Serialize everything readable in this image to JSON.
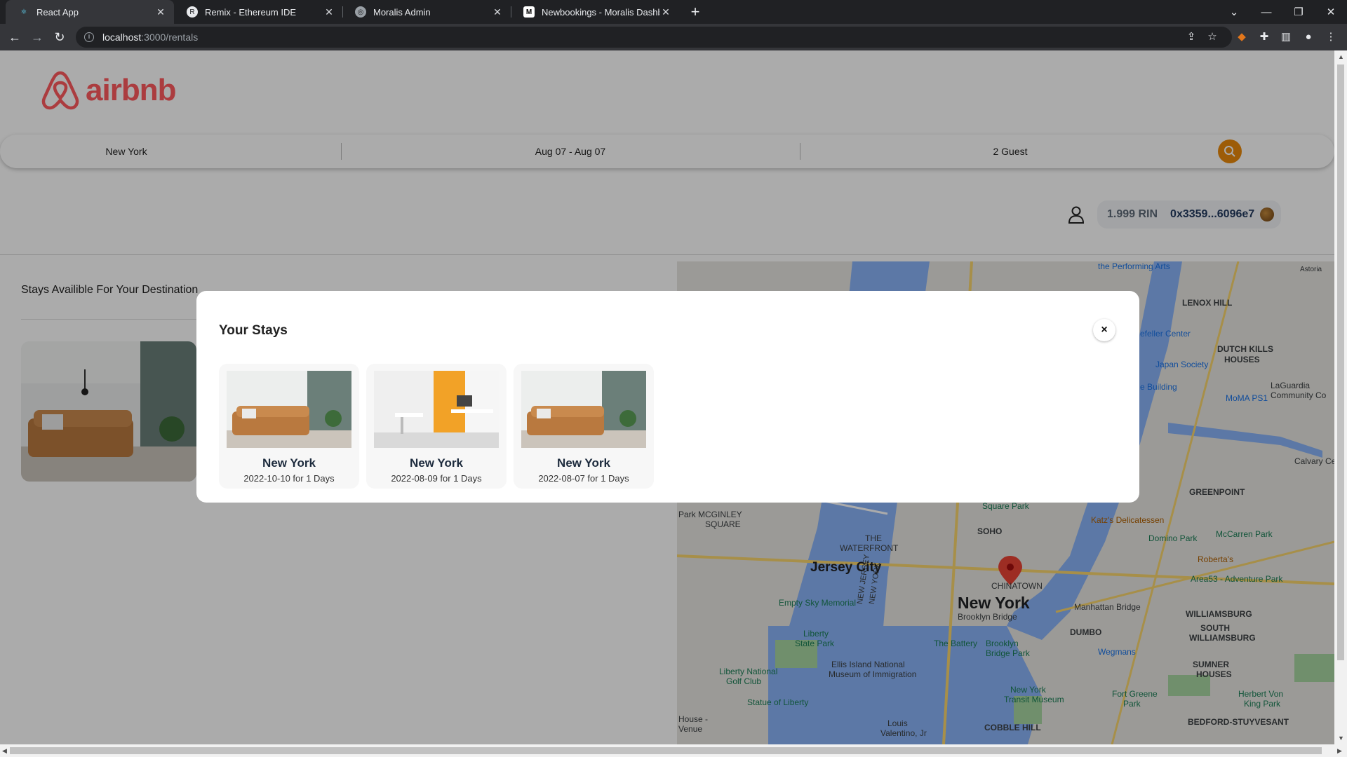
{
  "browser": {
    "tabs": [
      {
        "title": "React App",
        "active": true,
        "favicon": "react-icon"
      },
      {
        "title": "Remix - Ethereum IDE",
        "active": false,
        "favicon": "remix-icon"
      },
      {
        "title": "Moralis Admin",
        "active": false,
        "favicon": "moralis-icon"
      },
      {
        "title": "Newbookings - Moralis Dashboard",
        "active": false,
        "favicon": "moralis-m-icon"
      }
    ],
    "url_host": "localhost",
    "url_path": ":3000/rentals"
  },
  "header": {
    "logo_text": "airbnb",
    "search": {
      "location": "New York",
      "dates": "Aug 07 - Aug 07",
      "guests": "2 Guest"
    },
    "wallet": {
      "balance": "1.999 RIN",
      "address": "0x3359...6096e7"
    }
  },
  "main": {
    "stays_title": "Stays Availible For Your Destination"
  },
  "map": {
    "labels": [
      "the Performing Arts",
      "LENOX HILL",
      "Astoria",
      "efeller Center",
      "DUTCH KILLS",
      "HOUSES",
      "Japan Society",
      "e Building",
      "MoMA PS1",
      "LaGuardia",
      "Community Co",
      "Calvary Ce",
      "GREENPOINT",
      "Square Park",
      "Katz's Delicatessen",
      "Domino Park",
      "McCarren Park",
      "SOHO",
      "Park MCGINLEY",
      "SQUARE",
      "THE",
      "WATERFRONT",
      "Jersey City",
      "CHINATOWN",
      "New York",
      "Area53 - Adventure Park",
      "Manhattan Bridge",
      "WILLIAMSBURG",
      "Brooklyn Bridge",
      "Empty Sky Memorial",
      "Liberty",
      "State Park",
      "The Battery",
      "DUMBO",
      "SOUTH",
      "WILLIAMSBURG",
      "Roberta's",
      "Wegmans",
      "Brooklyn Bridge Park",
      "Liberty National",
      "Golf Club",
      "Ellis Island National",
      "Museum of Immigration",
      "SUMNER",
      "HOUSES",
      "New York",
      "Transit Museum",
      "Fort Greene",
      "Park",
      "Herbert Von",
      "King Park",
      "Statue of Liberty",
      "House -",
      "Venue",
      "Louis",
      "Valentino, Jr",
      "COBBLE HILL",
      "BEDFORD-STUYVESANT",
      "NEW JERSEY",
      "NEW YORK"
    ]
  },
  "modal": {
    "title": "Your Stays",
    "close_label": "×",
    "stays": [
      {
        "city": "New York",
        "detail": "2022-10-10 for 1 Days"
      },
      {
        "city": "New York",
        "detail": "2022-08-09 for 1 Days"
      },
      {
        "city": "New York",
        "detail": "2022-08-07 for 1 Days"
      }
    ]
  },
  "colors": {
    "brand": "#ff5a5f",
    "search_button": "#eb8a0b"
  }
}
